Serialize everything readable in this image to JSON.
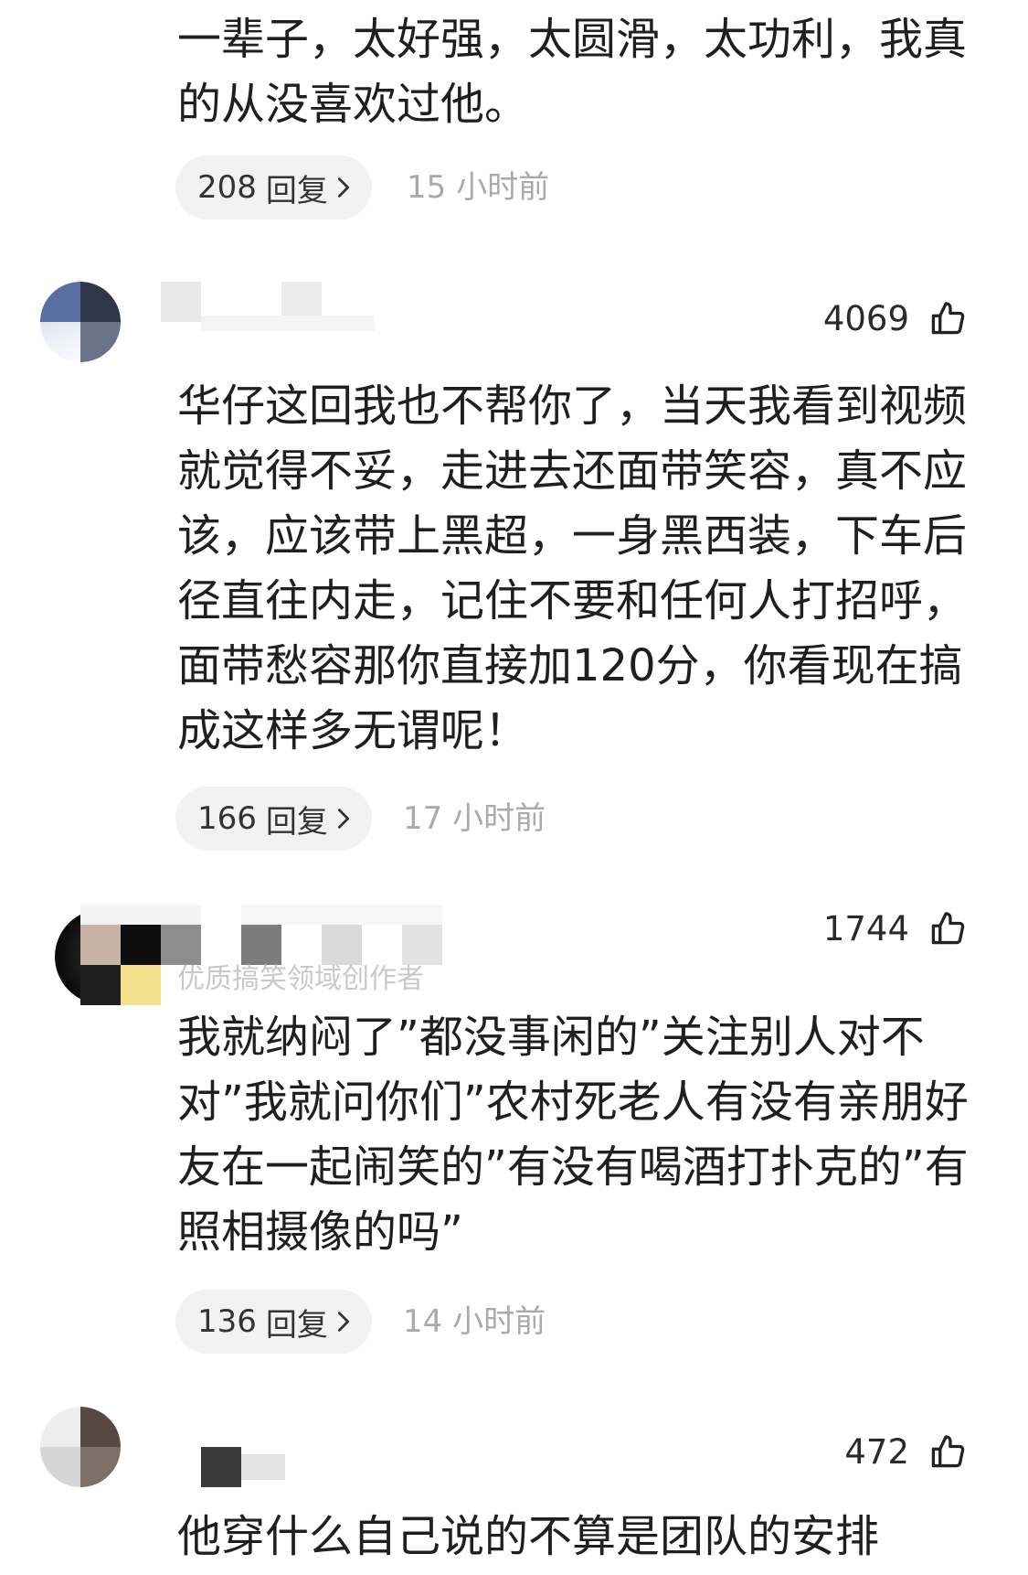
{
  "colors": {
    "text": "#1f1f1f",
    "meta_text": "#aaaaaa",
    "pill_background": "#f2f2f2"
  },
  "comments": [
    {
      "text_lines": [
        "一辈子，太好强，太圆滑，太功利，我真",
        "的从没喜欢过他。"
      ],
      "reply_count": "208",
      "reply_label": "回复",
      "reply_icon": "chevron-right-icon",
      "time": "15 小时前"
    },
    {
      "likes": "4069",
      "like_icon": "thumbs-up-icon",
      "text_lines": [
        "华仔这回我也不帮你了，当天我看到视频",
        "就觉得不妥，走进去还面带笑容，真不应",
        "该，应该带上黑超，一身黑西装，下车后",
        "径直往内走，记住不要和任何人打招呼，",
        "面带愁容那你直接加120分，你看现在搞",
        "成这样多无谓呢！"
      ],
      "reply_count": "166",
      "reply_label": "回复",
      "reply_icon": "chevron-right-icon",
      "time": "17 小时前"
    },
    {
      "likes": "1744",
      "like_icon": "thumbs-up-icon",
      "author_badge": "优质搞笑领域创作者",
      "text_lines": [
        "我就纳闷了”都没事闲的”关注别人对不",
        "对”我就问你们”农村死老人有没有亲朋好",
        "友在一起闹笑的”有没有喝酒打扑克的”有",
        "照相摄像的吗”"
      ],
      "reply_count": "136",
      "reply_label": "回复",
      "reply_icon": "chevron-right-icon",
      "time": "14 小时前"
    },
    {
      "likes": "472",
      "like_icon": "thumbs-up-icon",
      "text_lines": [
        "他穿什么自己说的不算是团队的安排"
      ]
    }
  ]
}
